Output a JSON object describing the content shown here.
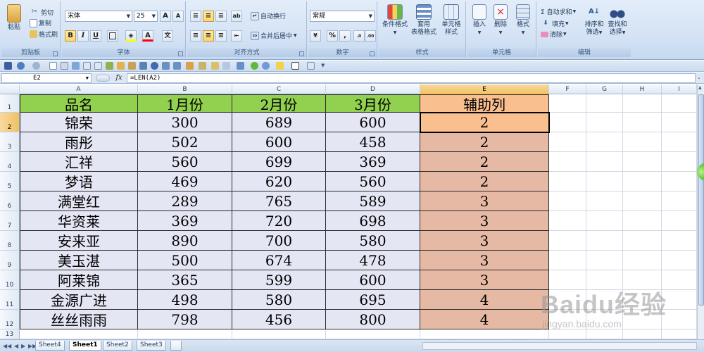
{
  "ribbon": {
    "clipboard": {
      "paste": "粘贴",
      "cut": "剪切",
      "copy": "复制",
      "format_painter": "格式刷",
      "label": "剪贴板"
    },
    "font": {
      "name": "宋体",
      "size": "25",
      "grow": "A",
      "shrink": "A",
      "bold": "B",
      "italic": "I",
      "underline": "U",
      "color_a": "A",
      "phonetic": "文",
      "label": "字体"
    },
    "alignment": {
      "wrap": "自动换行",
      "merge": "合并后居中",
      "label": "对齐方式"
    },
    "number": {
      "format": "常规",
      "percent": "%",
      "comma": ",",
      "label": "数字"
    },
    "styles": {
      "conditional": "条件格式",
      "table_format_1": "套用",
      "table_format_2": "表格格式",
      "cell_styles_1": "单元格",
      "cell_styles_2": "样式",
      "label": "样式"
    },
    "cells": {
      "insert": "插入",
      "delete": "删除",
      "format": "格式",
      "label": "单元格"
    },
    "editing": {
      "autosum": "Σ 自动求和",
      "fill": "填充",
      "clear": "清除",
      "sort_1": "排序和",
      "sort_2": "筛选",
      "find_1": "查找和",
      "find_2": "选择",
      "label": "编辑"
    }
  },
  "formula_bar": {
    "name_box": "E2",
    "fx": "fx",
    "formula": "=LEN(A2)"
  },
  "grid": {
    "columns": [
      "A",
      "B",
      "C",
      "D",
      "E",
      "F",
      "G",
      "H",
      "I"
    ],
    "row_numbers": [
      "1",
      "2",
      "3",
      "4",
      "5",
      "6",
      "7",
      "8",
      "9",
      "10",
      "11",
      "12",
      "13"
    ],
    "header": [
      "品名",
      "1月份",
      "2月份",
      "3月份",
      "辅助列"
    ],
    "rows": [
      [
        "锦荣",
        "300",
        "689",
        "600",
        "2"
      ],
      [
        "雨彤",
        "502",
        "600",
        "458",
        "2"
      ],
      [
        "汇祥",
        "560",
        "699",
        "369",
        "2"
      ],
      [
        "梦语",
        "469",
        "620",
        "560",
        "2"
      ],
      [
        "满堂红",
        "289",
        "765",
        "589",
        "3"
      ],
      [
        "华资莱",
        "369",
        "720",
        "698",
        "3"
      ],
      [
        "安来亚",
        "890",
        "700",
        "580",
        "3"
      ],
      [
        "美玉湛",
        "500",
        "674",
        "478",
        "3"
      ],
      [
        "阿莱锦",
        "365",
        "599",
        "600",
        "3"
      ],
      [
        "金源广进",
        "498",
        "580",
        "695",
        "4"
      ],
      [
        "丝丝雨雨",
        "798",
        "456",
        "800",
        "4"
      ]
    ]
  },
  "sheet_tabs": [
    "Sheet4",
    "Sheet1",
    "Sheet2",
    "Sheet3"
  ],
  "active_tab": "Sheet1",
  "watermark": {
    "brand": "Baidu经验",
    "url": "jingyan.baidu.com"
  },
  "colors": {
    "header_green": "#92d050",
    "aux_orange": "#fabf8f",
    "aux_body": "#e6b9a4",
    "body_lavender": "#e4e6f4",
    "selection": "#f1c15f"
  }
}
